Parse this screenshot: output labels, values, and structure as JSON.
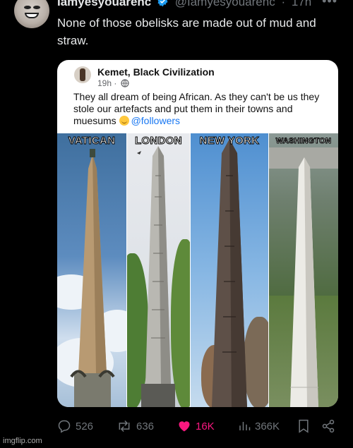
{
  "post": {
    "display_name": "Iamyesyouarenc",
    "handle": "@Iamyesyouarenc",
    "separator": "·",
    "time": "17h",
    "more": "•••",
    "text": "None of those obelisks are made out of mud and straw."
  },
  "quoted": {
    "name": "Kemet, Black Civilization",
    "time": "19h ·",
    "text": "They all dream of being African. As they can't be us they stole our artefacts and put them in their towns and muesums",
    "tag": "@followers",
    "panels": [
      "VATICAN",
      "LONDON",
      "NEW YORK",
      "WASHINGTON"
    ]
  },
  "actions": {
    "replies": "526",
    "reposts": "636",
    "likes": "16K",
    "views": "366K"
  },
  "colors": {
    "like": "#f91880",
    "verified": "#1d9bf0",
    "secondary": "#71767b"
  },
  "icons": [
    "verified-badge-icon",
    "globe-icon",
    "reply-icon",
    "repost-icon",
    "heart-icon",
    "views-icon",
    "bookmark-icon",
    "share-icon"
  ],
  "watermark": "imgflip.com"
}
